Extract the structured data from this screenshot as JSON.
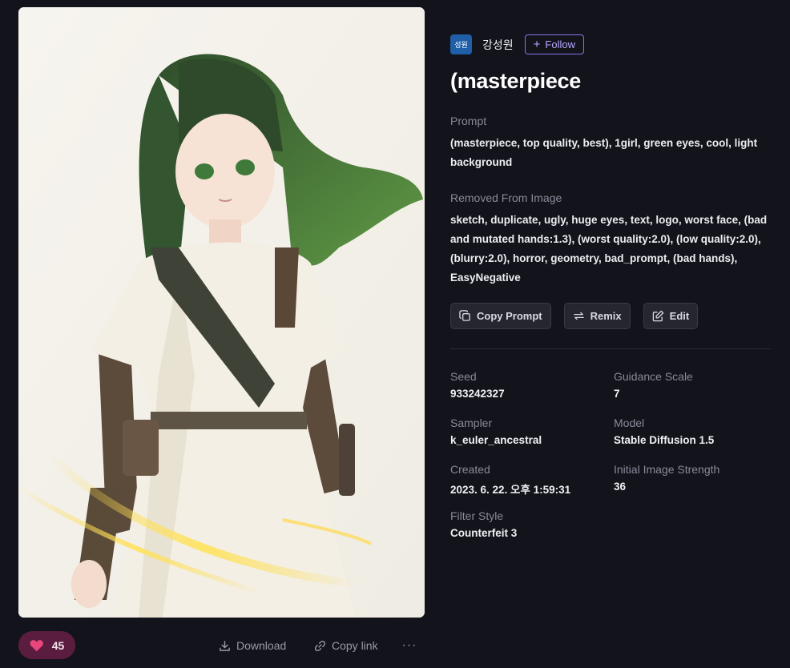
{
  "author": {
    "avatar_text": "성원",
    "name": "강성원",
    "follow_label": "Follow"
  },
  "title": "(masterpiece",
  "prompt": {
    "label": "Prompt",
    "text": "(masterpiece, top quality, best), 1girl, green eyes, cool, light background"
  },
  "negative": {
    "label": "Removed From Image",
    "text": "sketch, duplicate, ugly, huge eyes, text, logo, worst face, (bad and mutated hands:1.3), (worst quality:2.0), (low quality:2.0), (blurry:2.0), horror, geometry, bad_prompt, (bad hands), EasyNegative"
  },
  "buttons": {
    "copy_prompt": "Copy Prompt",
    "remix": "Remix",
    "edit": "Edit"
  },
  "meta": {
    "seed": {
      "label": "Seed",
      "value": "933242327"
    },
    "guidance": {
      "label": "Guidance Scale",
      "value": "7"
    },
    "sampler": {
      "label": "Sampler",
      "value": "k_euler_ancestral"
    },
    "model": {
      "label": "Model",
      "value": "Stable Diffusion 1.5"
    },
    "created": {
      "label": "Created",
      "value": "2023. 6. 22. 오후 1:59:31"
    },
    "strength": {
      "label": "Initial Image Strength",
      "value": "36"
    },
    "filter": {
      "label": "Filter Style",
      "value": "Counterfeit 3"
    }
  },
  "bottom_bar": {
    "like_count": "45",
    "download_label": "Download",
    "copy_link_label": "Copy link",
    "more_label": "···"
  },
  "colors": {
    "background": "#13131c",
    "accent": "#8a72ee",
    "like": "#e8467c"
  },
  "icons": [
    "plus-icon",
    "heart-icon",
    "download-icon",
    "link-icon",
    "more-icon",
    "copy-icon",
    "remix-icon",
    "edit-icon"
  ]
}
